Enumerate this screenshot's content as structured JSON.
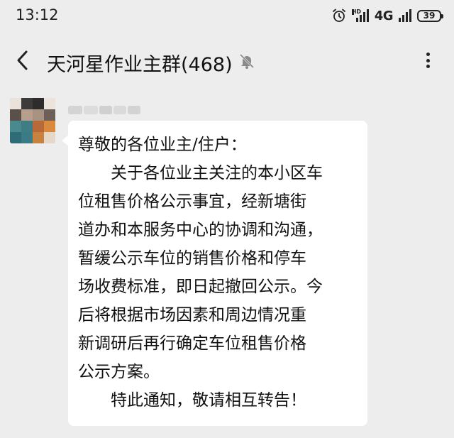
{
  "status_bar": {
    "time": "13:12",
    "hd_label": "HD",
    "network": "4G",
    "battery": "39"
  },
  "header": {
    "title": "天河星作业主群(468)",
    "icons": [
      "back-icon",
      "mute-icon",
      "more-icon"
    ]
  },
  "message": {
    "lines": [
      "尊敬的各位业主/住户：",
      "关于各位业主关注的本小区车",
      "位租售价格公示事宜，经新塘街",
      "道办和本服务中心的协调和沟通，",
      "暂缓公示车位的销售价格和停车",
      "场收费标准，即日起撤回公示。今",
      "后将根据市场因素和周边情况重",
      "新调研后再行确定车位租售价格",
      "公示方案。",
      "特此通知，敬请相互转告！"
    ]
  },
  "colors": {
    "background": "#ededed",
    "bubble": "#ffffff",
    "text": "#111111"
  }
}
